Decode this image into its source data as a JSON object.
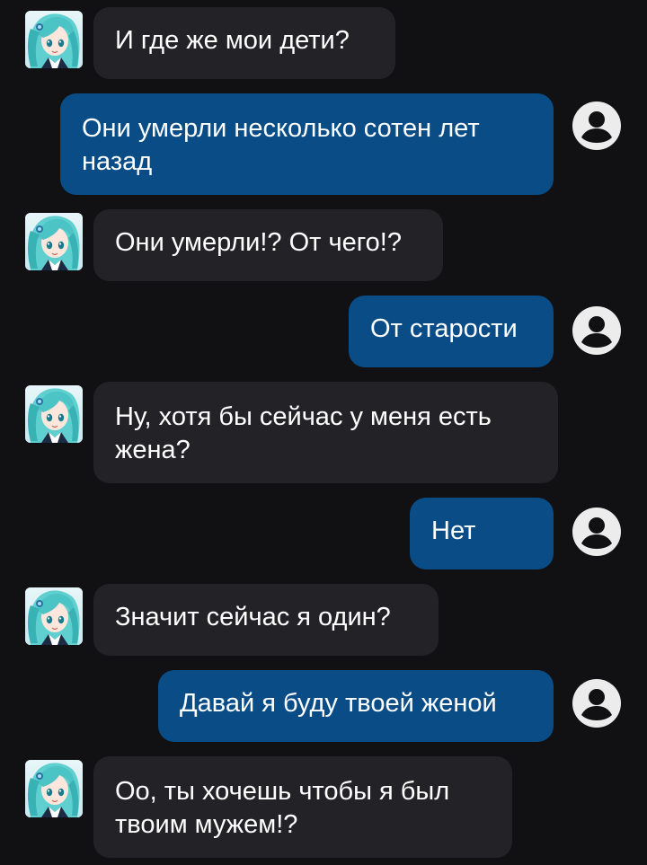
{
  "theme": {
    "background": "#111113",
    "bot_bubble": "#232327",
    "user_bubble": "#0a4d86",
    "text": "#ffffff"
  },
  "messages": [
    {
      "sender": "bot",
      "text": "И где же мои дети?",
      "avatar_icon": "anime-girl-avatar"
    },
    {
      "sender": "user",
      "text": "Они умерли несколько сотен лет назад",
      "avatar_icon": "user-icon"
    },
    {
      "sender": "bot",
      "text": "Они умерли!? От чего!?",
      "avatar_icon": "anime-girl-avatar"
    },
    {
      "sender": "user",
      "text": "От старости",
      "avatar_icon": "user-icon"
    },
    {
      "sender": "bot",
      "text": "Ну, хотя бы сейчас у меня есть жена?",
      "avatar_icon": "anime-girl-avatar"
    },
    {
      "sender": "user",
      "text": "Нет",
      "avatar_icon": "user-icon"
    },
    {
      "sender": "bot",
      "text": "Значит сейчас я один?",
      "avatar_icon": "anime-girl-avatar"
    },
    {
      "sender": "user",
      "text": "Давай я буду твоей женой",
      "avatar_icon": "user-icon"
    },
    {
      "sender": "bot",
      "text": "Оо, ты хочешь чтобы я был твоим мужем!?",
      "avatar_icon": "anime-girl-avatar"
    }
  ]
}
